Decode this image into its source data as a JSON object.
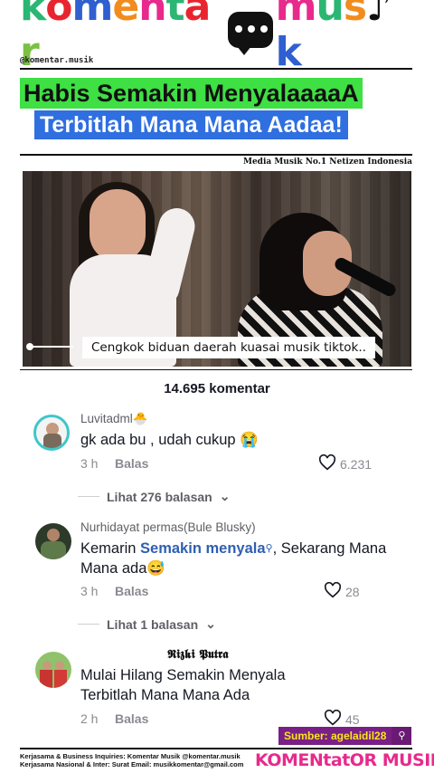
{
  "brand": {
    "logo_letters": [
      {
        "ch": "k",
        "color": "#2bb673"
      },
      {
        "ch": "o",
        "color": "#e8252f"
      },
      {
        "ch": "m",
        "color": "#2f5fd0"
      },
      {
        "ch": "e",
        "color": "#f28c1e"
      },
      {
        "ch": "n",
        "color": "#e72a8c"
      },
      {
        "ch": "t",
        "color": "#2bb673"
      },
      {
        "ch": "a",
        "color": "#e8252f"
      },
      {
        "ch": "r",
        "color": "#7ac143"
      }
    ],
    "logo_letters_2": [
      {
        "ch": "m",
        "color": "#e72a8c"
      },
      {
        "ch": "u",
        "color": "#2bb673"
      },
      {
        "ch": "s",
        "color": "#f28c1e"
      },
      {
        "ch": "♪",
        "color": "#111111"
      },
      {
        "ch": "k",
        "color": "#2f5fd0"
      }
    ],
    "handle": "@komentar.musik",
    "tagline": "Media Musik No.1 Netizen Indonesia"
  },
  "headline": {
    "line1": "Habis Semakin MenyalaaaaA",
    "line2": "Terbitlah Mana Mana Aadaa!"
  },
  "video": {
    "caption": "Cengkok biduan daerah kuasai musik tiktok.."
  },
  "comments_header": {
    "count": "14.695 komentar"
  },
  "comments": [
    {
      "user": "Luvitadml",
      "user_badge": "🐣",
      "text": "gk ada bu , udah cukup 😭",
      "time": "3 h",
      "reply": "Balas",
      "likes": "6.231",
      "view_replies": "Lihat 276 balasan"
    },
    {
      "user": "Nurhidayat permas(Bule Blusky)",
      "text_before": "Kemarin ",
      "text_highlight": "Semakin menyala",
      "text_after": ", Sekarang Mana Mana ada😅",
      "time": "3 h",
      "reply": "Balas",
      "likes": "28",
      "view_replies": "Lihat 1 balasan"
    },
    {
      "user": "𝕽𝖎𝖟𝖐𝖎 𝕻𝖚𝖙𝖗𝖆",
      "text": "Mulai Hilang Semakin Menyala Terbitlah Mana Mana Ada",
      "time": "2 h",
      "reply": "Balas",
      "likes": "45"
    }
  ],
  "source": {
    "label": "Sumber: agelaidil28"
  },
  "footer": {
    "line1": "Kerjasama & Business Inquiries: Komentar Musik @komentar.musik",
    "line2": "Kerjasama Nasional & Inter: Surat Email: musikkomentar@gmail.com",
    "logo": "KOMENtatOR MUSIK"
  },
  "colors": {
    "headline1_bg": "#3ee043",
    "headline2_bg": "#2f6fe0",
    "source_bg": "#7a1f86",
    "source_text": "#f7e81a",
    "highlight_link": "#2f5fb0"
  }
}
